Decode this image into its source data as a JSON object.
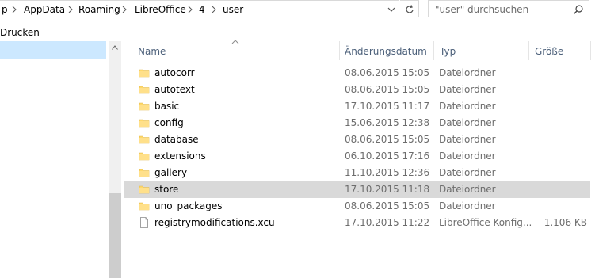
{
  "address": {
    "crumbs": [
      "p",
      "AppData",
      "Roaming",
      "LibreOffice",
      "4",
      "user"
    ],
    "dropdown_icon": "chevron-down-icon",
    "refresh_icon": "refresh-icon"
  },
  "search": {
    "placeholder": "\"user\" durchsuchen",
    "icon": "search-icon"
  },
  "menu": {
    "drucken": "Drucken"
  },
  "columns": {
    "name": "Name",
    "date": "Änderungsdatum",
    "type": "Typ",
    "size": "Größe"
  },
  "rows": [
    {
      "name": "autocorr",
      "date": "08.06.2015 15:05",
      "type": "Dateiordner",
      "size": "",
      "icon": "folder-icon"
    },
    {
      "name": "autotext",
      "date": "08.06.2015 15:05",
      "type": "Dateiordner",
      "size": "",
      "icon": "folder-icon"
    },
    {
      "name": "basic",
      "date": "17.10.2015 11:17",
      "type": "Dateiordner",
      "size": "",
      "icon": "folder-icon"
    },
    {
      "name": "config",
      "date": "15.06.2015 12:38",
      "type": "Dateiordner",
      "size": "",
      "icon": "folder-icon"
    },
    {
      "name": "database",
      "date": "08.06.2015 15:05",
      "type": "Dateiordner",
      "size": "",
      "icon": "folder-icon"
    },
    {
      "name": "extensions",
      "date": "06.10.2015 17:16",
      "type": "Dateiordner",
      "size": "",
      "icon": "folder-icon"
    },
    {
      "name": "gallery",
      "date": "11.10.2015 12:36",
      "type": "Dateiordner",
      "size": "",
      "icon": "folder-icon"
    },
    {
      "name": "store",
      "date": "17.10.2015 11:18",
      "type": "Dateiordner",
      "size": "",
      "icon": "folder-icon",
      "selected": true
    },
    {
      "name": "uno_packages",
      "date": "08.06.2015 15:05",
      "type": "Dateiordner",
      "size": "",
      "icon": "folder-icon"
    },
    {
      "name": "registrymodifications.xcu",
      "date": "17.10.2015 11:22",
      "type": "LibreOffice Konfig...",
      "size": "1.106 KB",
      "icon": "file-icon"
    }
  ],
  "colors": {
    "folder": "#ffd86a",
    "header_text": "#4c607a",
    "selection": "#d9d9d9",
    "nav_selection": "#cce8ff"
  }
}
